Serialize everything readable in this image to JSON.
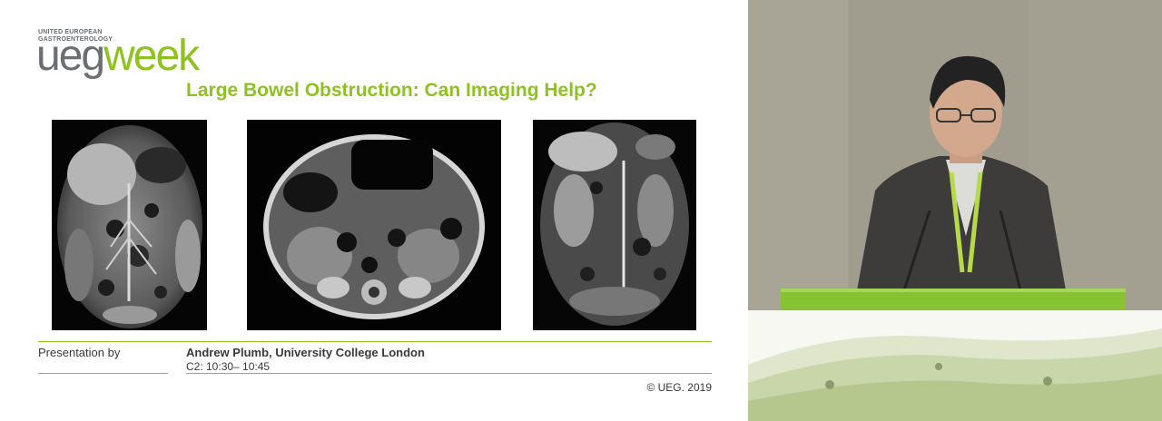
{
  "slide": {
    "logo": {
      "small_line1": "UNITED EUROPEAN",
      "small_line2": "GASTROENTEROLOGY",
      "word_ueg": "ueg",
      "word_week": "week"
    },
    "title": "Large Bowel Obstruction: Can Imaging Help?",
    "images": [
      {
        "name": "coronal-ct-scan"
      },
      {
        "name": "axial-mri-scan"
      },
      {
        "name": "coronal-mri-scan"
      }
    ],
    "footer": {
      "presented_by_label": "Presentation by",
      "presenter": "Andrew Plumb, University College London",
      "session": "C2: 10:30– 10:45",
      "copyright": "© UEG. 2019"
    }
  },
  "colors": {
    "brand_green": "#8dc21f",
    "logo_gray": "#6b6f73",
    "text": "#3a3a3a"
  }
}
